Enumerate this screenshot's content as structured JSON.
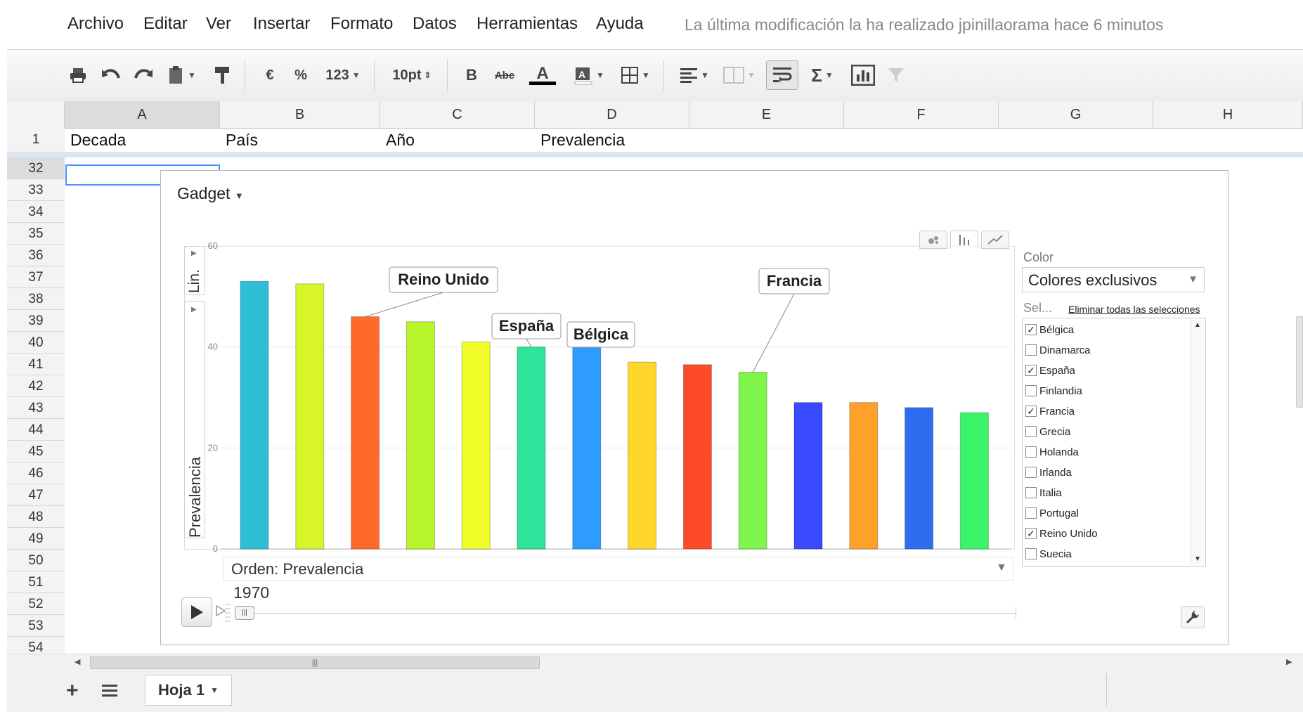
{
  "menu": {
    "items": [
      "Archivo",
      "Editar",
      "Ver",
      "Insertar",
      "Formato",
      "Datos",
      "Herramientas",
      "Ayuda"
    ],
    "last_modified": "La última modificación la ha realizado jpinillaorama hace 6 minutos"
  },
  "toolbar": {
    "currency": "€",
    "percent": "%",
    "number_format": "123",
    "font_size": "10pt",
    "bold": "B",
    "strike": "Abc",
    "text_color": "A",
    "sum": "Σ"
  },
  "columns": [
    "A",
    "B",
    "C",
    "D",
    "E",
    "F",
    "G",
    "H"
  ],
  "header_row": {
    "row_number": "1",
    "cells": [
      "Decada",
      "País",
      "Año",
      "Prevalencia"
    ]
  },
  "row_numbers": [
    "32",
    "33",
    "34",
    "35",
    "36",
    "37",
    "38",
    "39",
    "40",
    "41",
    "42",
    "43",
    "44",
    "45",
    "46",
    "47",
    "48",
    "49",
    "50",
    "51",
    "52",
    "53",
    "54"
  ],
  "gadget": {
    "title": "Gadget",
    "x_axis_tab": "Lin.",
    "y_axis_label": "Prevalencia",
    "sort_label": "Orden: Prevalencia",
    "year": "1970",
    "color_label": "Color",
    "color_value": "Colores exclusivos",
    "select_label": "Sel...",
    "clear_selection": "Eliminar todas las selecciones",
    "countries": [
      {
        "name": "Bélgica",
        "checked": true
      },
      {
        "name": "Dinamarca",
        "checked": false
      },
      {
        "name": "España",
        "checked": true
      },
      {
        "name": "Finlandia",
        "checked": false
      },
      {
        "name": "Francia",
        "checked": true
      },
      {
        "name": "Grecia",
        "checked": false
      },
      {
        "name": "Holanda",
        "checked": false
      },
      {
        "name": "Irlanda",
        "checked": false
      },
      {
        "name": "Italia",
        "checked": false
      },
      {
        "name": "Portugal",
        "checked": false
      },
      {
        "name": "Reino Unido",
        "checked": true
      },
      {
        "name": "Suecia",
        "checked": false
      }
    ]
  },
  "chart_data": {
    "type": "bar",
    "ylim": [
      0,
      60
    ],
    "yticks": [
      0,
      20,
      40,
      60
    ],
    "values": [
      53,
      52.5,
      46,
      45,
      41,
      40,
      40,
      37,
      36.5,
      35,
      29,
      29,
      28,
      27
    ],
    "colors": [
      "#2ebfd6",
      "#d8f52a",
      "#ff6a2a",
      "#b8f52a",
      "#f0ff2a",
      "#2ee39a",
      "#2e9cff",
      "#ffd62a",
      "#ff4a2a",
      "#7df54a",
      "#3a4aff",
      "#ffa02a",
      "#2e6cf0",
      "#3af56a"
    ],
    "annotations": [
      {
        "label": "Reino Unido",
        "bar_index": 2
      },
      {
        "label": "España",
        "bar_index": 5
      },
      {
        "label": "Bélgica",
        "bar_index": 6
      },
      {
        "label": "Francia",
        "bar_index": 9
      }
    ]
  },
  "sheet": {
    "tab_label": "Hoja 1"
  }
}
